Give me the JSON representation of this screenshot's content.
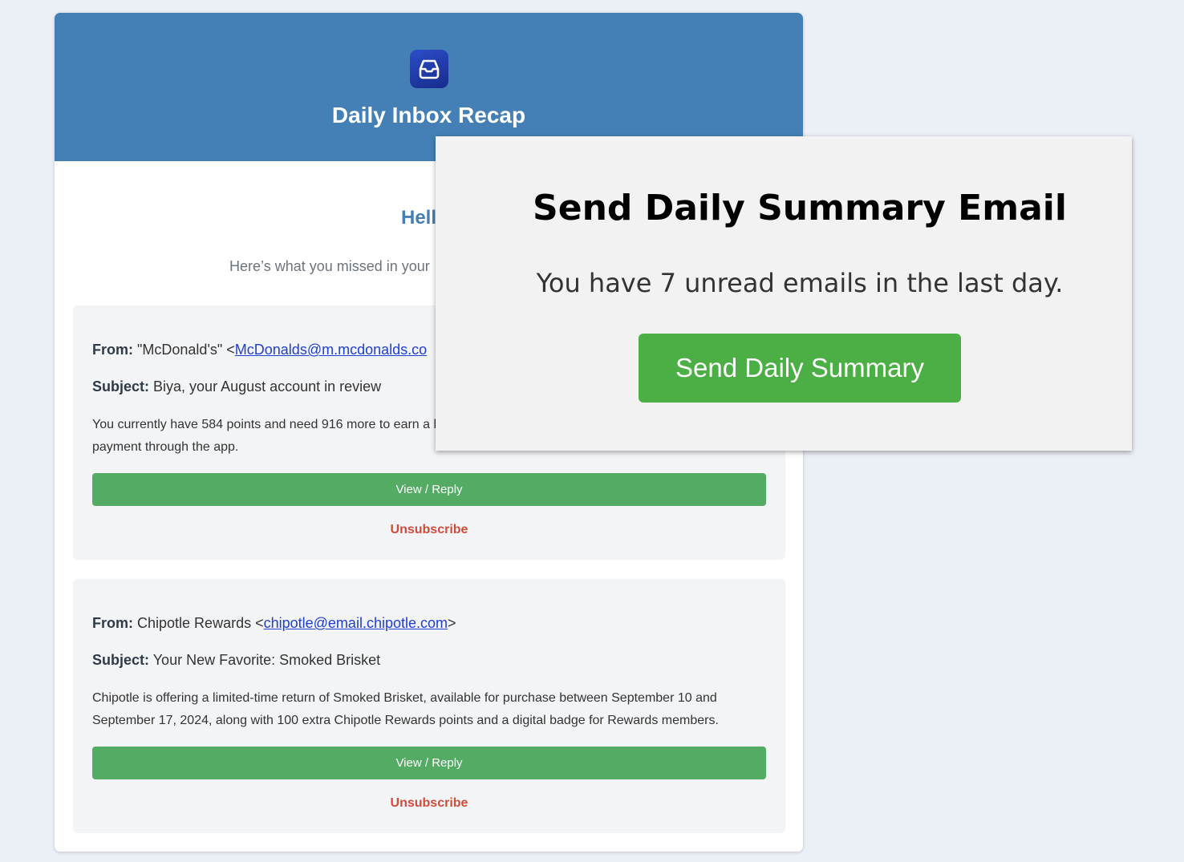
{
  "email": {
    "title": "Daily Inbox Recap",
    "greeting": "Hell",
    "intro": "Here’s what you missed in your",
    "items": [
      {
        "from_label": "From:",
        "from_name": "\"McDonald's\" <",
        "from_email": "McDonalds@m.mcdonalds.co",
        "from_close": "",
        "subject_label": "Subject:",
        "subject": "Biya, your August account in review",
        "snippet": "You currently have 584 points and need 916 more to earn a bonus points by linking your card and making your first payment through the app.",
        "view_reply": "View / Reply",
        "unsubscribe": "Unsubscribe"
      },
      {
        "from_label": "From:",
        "from_name": "Chipotle Rewards <",
        "from_email": "chipotle@email.chipotle.com",
        "from_close": ">",
        "subject_label": "Subject:",
        "subject": "Your New Favorite: Smoked Brisket",
        "snippet": "Chipotle is offering a limited-time return of Smoked Brisket, available for purchase between September 10 and September 17, 2024, along with 100 extra Chipotle Rewards points and a digital badge for Rewards members.",
        "view_reply": "View / Reply",
        "unsubscribe": "Unsubscribe"
      }
    ]
  },
  "panel": {
    "title": "Send Daily Summary Email",
    "subtitle": "You have 7 unread emails in the last day.",
    "button_label": "Send Daily Summary"
  },
  "icons": {
    "app_logo": "inbox-tray-icon"
  },
  "colors": {
    "header_blue": "#4480b5",
    "view_reply_green": "#53ab64",
    "send_button_green": "#4caf45",
    "unsubscribe_red": "#d04b3a",
    "link_blue": "#1f3fd0"
  }
}
